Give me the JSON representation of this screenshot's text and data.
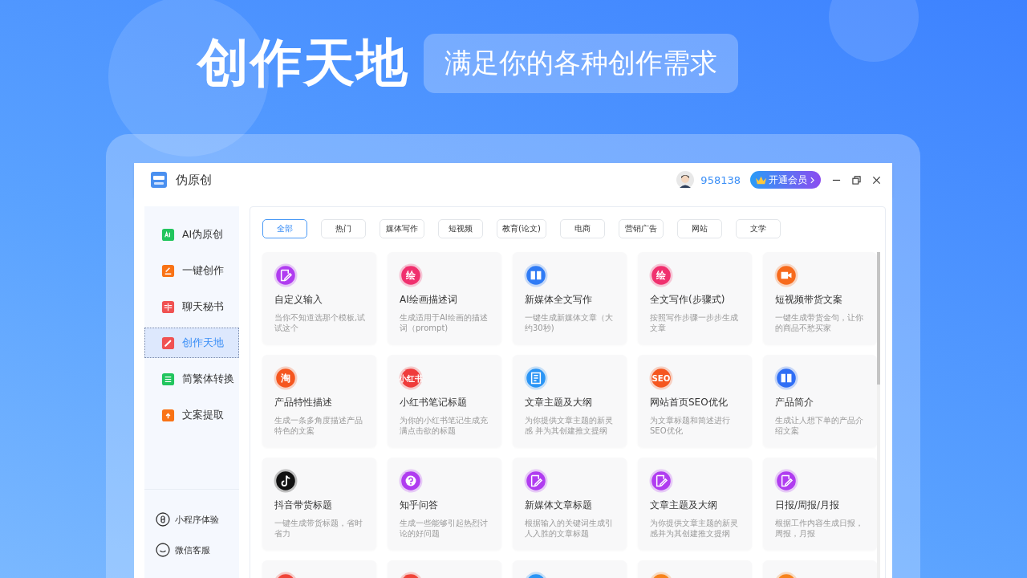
{
  "banner": {
    "title": "创作天地",
    "subtitle": "满足你的各种创作需求"
  },
  "window": {
    "title": "伪原创",
    "user_id": "958138",
    "vip_button": "开通会员"
  },
  "sidebar": {
    "items": [
      {
        "label": "AI伪原创",
        "kind": "ai",
        "color": "#22c55e",
        "selected": false
      },
      {
        "label": "一键创作",
        "kind": "edit",
        "color": "#f97316",
        "selected": false
      },
      {
        "label": "聊天秘书",
        "kind": "book",
        "color": "#f05252",
        "selected": false
      },
      {
        "label": "创作天地",
        "kind": "pen",
        "color": "#f05252",
        "selected": true
      },
      {
        "label": "简繁体转换",
        "kind": "convert",
        "color": "#22c55e",
        "selected": false
      },
      {
        "label": "文案提取",
        "kind": "upload",
        "color": "#f97316",
        "selected": false
      }
    ],
    "footer": [
      {
        "label": "小程序体验",
        "kind": "link"
      },
      {
        "label": "微信客服",
        "kind": "chat"
      }
    ]
  },
  "tabs": [
    {
      "label": "全部",
      "selected": true
    },
    {
      "label": "热门",
      "selected": false
    },
    {
      "label": "媒体写作",
      "selected": false
    },
    {
      "label": "短视频",
      "selected": false
    },
    {
      "label": "教育(论文)",
      "selected": false
    },
    {
      "label": "电商",
      "selected": false
    },
    {
      "label": "营销广告",
      "selected": false
    },
    {
      "label": "网站",
      "selected": false
    },
    {
      "label": "文学",
      "selected": false
    }
  ],
  "cards": [
    {
      "title": "自定义输入",
      "desc": "当你不知道选那个模板,试试这个",
      "kind": "edit",
      "color": "#b03cf0"
    },
    {
      "title": "AI绘画描述词",
      "desc": "生成适用于AI绘画的描述词（prompt)",
      "kind": "text",
      "badge": "绘",
      "color": "#f0306e"
    },
    {
      "title": "新媒体全文写作",
      "desc": "一键生成新媒体文章（大约30秒)",
      "kind": "book",
      "color": "#2f7bf5"
    },
    {
      "title": "全文写作(步骤式)",
      "desc": "按照写作步骤一步步生成文章",
      "kind": "text",
      "badge": "绘",
      "color": "#f0306e"
    },
    {
      "title": "短视频带货文案",
      "desc": "一键生成带货金句，让你的商品不愁买家",
      "kind": "video",
      "color": "#f76a1c"
    },
    {
      "title": "产品特性描述",
      "desc": "生成一条多角度描述产品特色的文案",
      "kind": "text",
      "badge": "淘",
      "color": "#f5561f"
    },
    {
      "title": "小红书笔记标题",
      "desc": "为你的小红书笔记生成充满点击欲的标题",
      "kind": "text",
      "badge": "小红书",
      "color": "#ef3b3b"
    },
    {
      "title": "文章主题及大纲",
      "desc": "为你提供文章主题的新灵感 并为其创建推文提纲",
      "kind": "doc",
      "color": "#2a95f5"
    },
    {
      "title": "网站首页SEO优化",
      "desc": "为文章标题和简述进行SEO优化",
      "kind": "text",
      "badge": "SEO",
      "color": "#f5561f"
    },
    {
      "title": "产品简介",
      "desc": "生成让人想下单的产品介绍文案",
      "kind": "book",
      "color": "#2f6ef5"
    },
    {
      "title": "抖音带货标题",
      "desc": "一键生成带货标题，省时省力",
      "kind": "tiktok",
      "color": "#111111"
    },
    {
      "title": "知乎问答",
      "desc": "生成一些能够引起热烈讨论的好问题",
      "kind": "question",
      "color": "#b03cf0"
    },
    {
      "title": "新媒体文章标题",
      "desc": "根据输入的关键词生成引人入胜的文章标题",
      "kind": "edit",
      "color": "#b03cf0"
    },
    {
      "title": "文章主题及大纲",
      "desc": "为你提供文章主题的新灵感并为其创建推文提纲",
      "kind": "edit",
      "color": "#b03cf0"
    },
    {
      "title": "日报/周报/月报",
      "desc": "根据工作内容生成日报，周报，月报",
      "kind": "edit",
      "color": "#b03cf0"
    },
    {
      "kind": "plain",
      "color": "#f04438"
    },
    {
      "kind": "plain",
      "color": "#f04438"
    },
    {
      "kind": "plain",
      "color": "#2a95f5"
    },
    {
      "kind": "plain",
      "color": "#f7831c"
    },
    {
      "kind": "plain",
      "color": "#f7831c"
    }
  ]
}
